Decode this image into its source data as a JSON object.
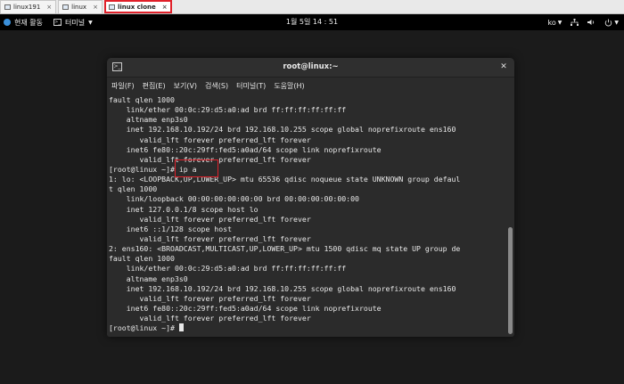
{
  "vm_tabs": [
    {
      "label": "linux191"
    },
    {
      "label": "linux"
    },
    {
      "label": "linux clone"
    }
  ],
  "topbar": {
    "activities": "현재 활동",
    "app_name": "터미널",
    "clock": "1월 5일 14 : 51",
    "input_method": "ko"
  },
  "terminal": {
    "title": "root@linux:~",
    "menu": [
      "파일(F)",
      "편집(E)",
      "보기(V)",
      "검색(S)",
      "터미널(T)",
      "도움말(H)"
    ],
    "lines": [
      "fault qlen 1000",
      "    link/ether 00:0c:29:d5:a0:ad brd ff:ff:ff:ff:ff:ff",
      "    altname enp3s0",
      "    inet 192.168.10.192/24 brd 192.168.10.255 scope global noprefixroute ens160",
      "       valid_lft forever preferred_lft forever",
      "    inet6 fe80::20c:29ff:fed5:a0ad/64 scope link noprefixroute",
      "       valid_lft forever preferred_lft forever",
      "[root@linux ~]# ip a",
      "1: lo: <LOOPBACK,UP,LOWER_UP> mtu 65536 qdisc noqueue state UNKNOWN group defaul",
      "t qlen 1000",
      "    link/loopback 00:00:00:00:00:00 brd 00:00:00:00:00:00",
      "    inet 127.0.0.1/8 scope host lo",
      "       valid_lft forever preferred_lft forever",
      "    inet6 ::1/128 scope host",
      "       valid_lft forever preferred_lft forever",
      "2: ens160: <BROADCAST,MULTICAST,UP,LOWER_UP> mtu 1500 qdisc mq state UP group de",
      "fault qlen 1000",
      "    link/ether 00:0c:29:d5:a0:ad brd ff:ff:ff:ff:ff:ff",
      "    altname enp3s0",
      "    inet 192.168.10.192/24 brd 192.168.10.255 scope global noprefixroute ens160",
      "       valid_lft forever preferred_lft forever",
      "    inet6 fe80::20c:29ff:fed5:a0ad/64 scope link noprefixroute",
      "       valid_lft forever preferred_lft forever"
    ],
    "prompt": "[root@linux ~]# "
  },
  "colors": {
    "highlight": "#e0202a",
    "terminal_bg": "#2b2b2b",
    "topbar_bg": "#000000"
  }
}
